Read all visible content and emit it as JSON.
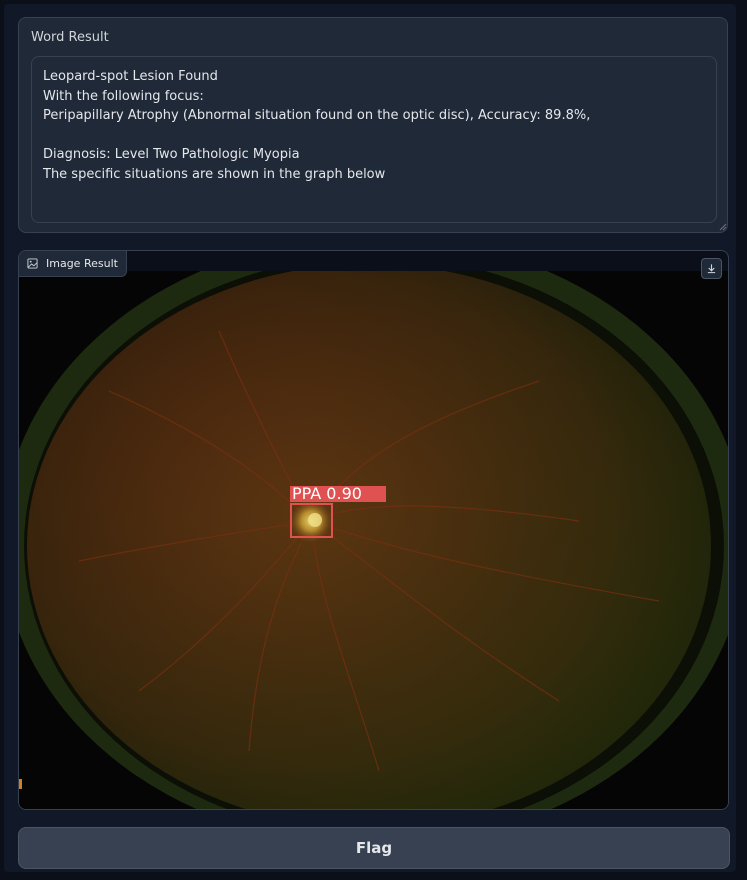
{
  "word_result": {
    "label": "Word Result",
    "text": "Leopard-spot Lesion Found\nWith the following focus:\nPeripapillary Atrophy (Abnormal situation found on the optic disc), Accuracy: 89.8%,\n\nDiagnosis: Level Two Pathologic Myopia\nThe specific situations are shown in the graph below"
  },
  "image_result": {
    "label": "Image Result",
    "label_icon": "image-icon",
    "download_icon": "download-icon",
    "detection": {
      "label": "PPA 0.90",
      "box_color": "#e05252"
    }
  },
  "flag_button": {
    "label": "Flag"
  },
  "colors": {
    "page_bg": "#0b0f19",
    "panel_bg": "#1f2937",
    "border": "#374151",
    "text": "#e5e7eb",
    "button_bg": "#374151"
  }
}
